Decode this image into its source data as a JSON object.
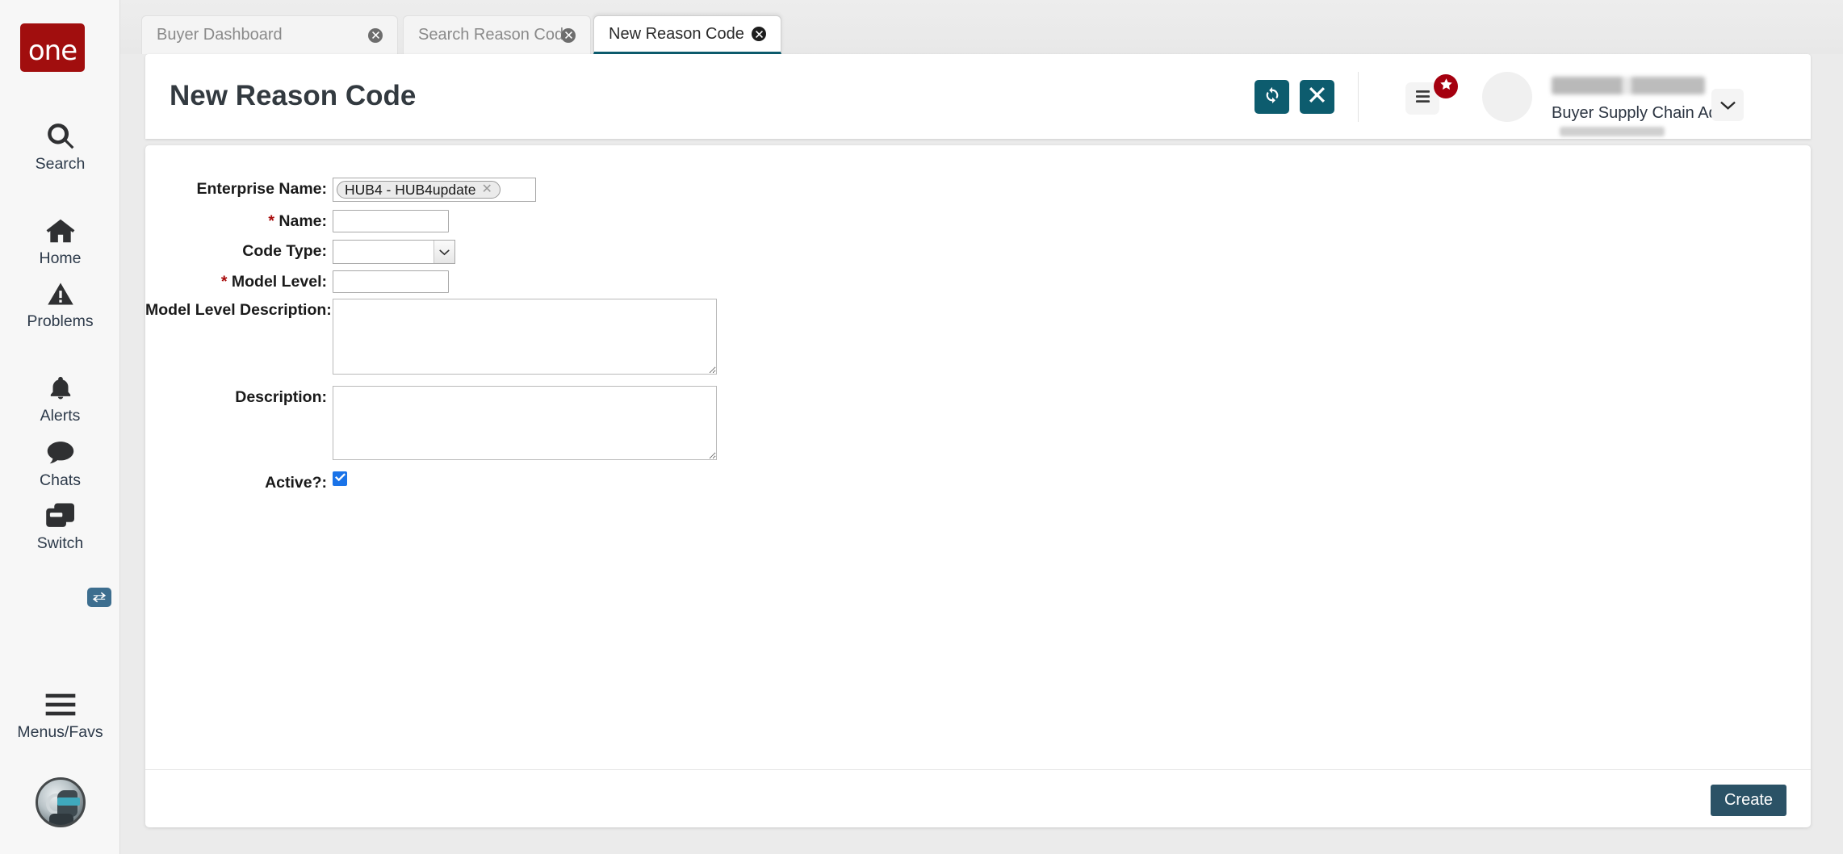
{
  "brand": {
    "logo_text": "one",
    "logo_color": "#a10e0e"
  },
  "sidebar": {
    "items": [
      {
        "label": "Search",
        "icon": "search-icon"
      },
      {
        "label": "Home",
        "icon": "home-icon"
      },
      {
        "label": "Problems",
        "icon": "warning-triangle-icon"
      },
      {
        "label": "Alerts",
        "icon": "bell-icon"
      },
      {
        "label": "Chats",
        "icon": "chat-bubble-icon"
      },
      {
        "label": "Switch",
        "icon": "switch-windows-icon"
      },
      {
        "label": "Menus/Favs",
        "icon": "hamburger-icon"
      }
    ],
    "assistant_icon": "assistant-avatar-icon"
  },
  "tabs": [
    {
      "label": "Buyer Dashboard",
      "active": false
    },
    {
      "label": "Search Reason Code",
      "active": false
    },
    {
      "label": "New Reason Code",
      "active": true
    }
  ],
  "header": {
    "title": "New Reason Code",
    "refresh_icon": "refresh-icon",
    "close_icon": "close-x-icon",
    "menu_icon": "menu-list-icon",
    "favorite_badge_icon": "star-icon",
    "accent_color": "#0d5c6e",
    "badge_color": "#a5000f",
    "user": {
      "role": "Buyer Supply Chain Admin",
      "avatar_icon": "user-avatar",
      "caret_icon": "chevron-down-icon"
    }
  },
  "form": {
    "fields": {
      "enterprise_name": {
        "label": "Enterprise Name:",
        "required": false,
        "chip_value": "HUB4 - HUB4update",
        "chip_remove_icon": "remove-x-icon"
      },
      "name": {
        "label": "Name:",
        "required": true,
        "value": ""
      },
      "code_type": {
        "label": "Code Type:",
        "required": false,
        "value": "",
        "caret_icon": "chevron-down-icon"
      },
      "model_level": {
        "label": "Model Level:",
        "required": true,
        "value": ""
      },
      "model_level_description": {
        "label": "Model Level Description:",
        "required": false,
        "value": ""
      },
      "description": {
        "label": "Description:",
        "required": false,
        "value": ""
      },
      "active": {
        "label": "Active?:",
        "required": false,
        "checked": true,
        "check_icon": "checkmark-icon",
        "color": "#1a73e8"
      }
    },
    "required_marker": "*"
  },
  "footer": {
    "create_label": "Create",
    "create_color": "#2b5266"
  }
}
